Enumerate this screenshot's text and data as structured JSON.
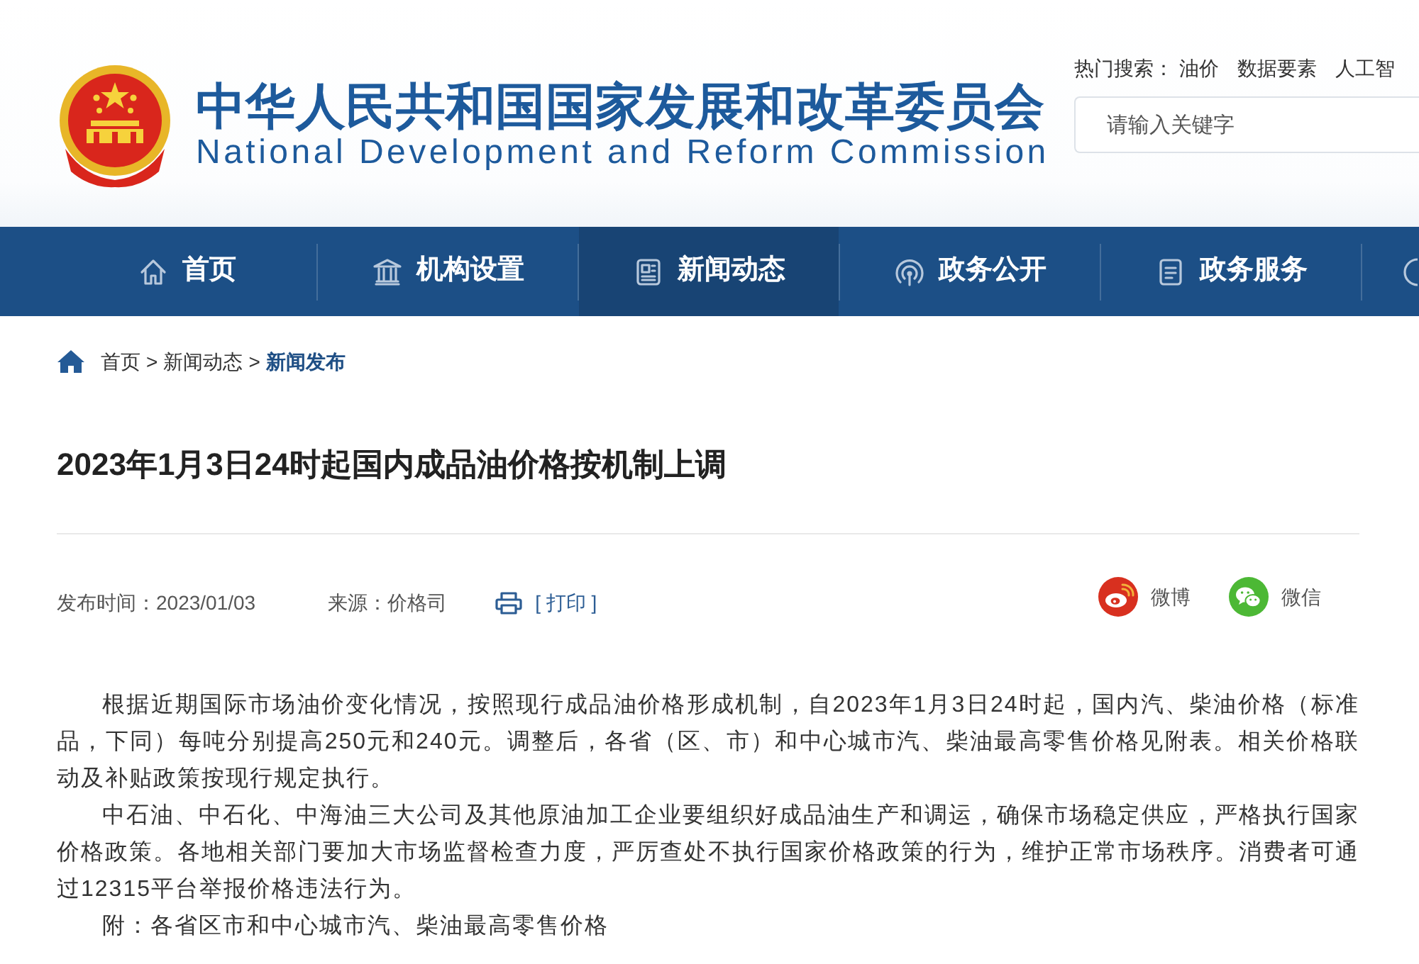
{
  "header": {
    "title_cn": "中华人民共和国国家发展和改革委员会",
    "title_en": "National Development and Reform Commission",
    "hot_search": {
      "label": "热门搜索：",
      "terms": [
        "油价",
        "数据要素",
        "人工智"
      ]
    },
    "search": {
      "placeholder": "请输入关键字"
    }
  },
  "nav": [
    {
      "label": "首页",
      "selected": false
    },
    {
      "label": "机构设置",
      "selected": false
    },
    {
      "label": "新闻动态",
      "selected": true
    },
    {
      "label": "政务公开",
      "selected": false
    },
    {
      "label": "政务服务",
      "selected": false
    }
  ],
  "breadcrumb": {
    "separator": ">",
    "items": [
      {
        "label": "首页",
        "current": false
      },
      {
        "label": "新闻动态",
        "current": false
      },
      {
        "label": "新闻发布",
        "current": true
      }
    ]
  },
  "article": {
    "title": "2023年1月3日24时起国内成品油价格按机制上调",
    "meta": {
      "published": "发布时间：2023/01/03",
      "source": "来源：价格司",
      "print": "[ 打印 ]"
    },
    "share": [
      {
        "kind": "weibo",
        "label": "微博"
      },
      {
        "kind": "wechat",
        "label": "微信"
      }
    ],
    "paragraphs": [
      "根据近期国际市场油价变化情况，按照现行成品油价格形成机制，自2023年1月3日24时起，国内汽、柴油价格（标准品，下同）每吨分别提高250元和240元。调整后，各省（区、市）和中心城市汽、柴油最高零售价格见附表。相关价格联动及补贴政策按现行规定执行。",
      "中石油、中石化、中海油三大公司及其他原油加工企业要组织好成品油生产和调运，确保市场稳定供应，严格执行国家价格政策。各地相关部门要加大市场监督检查力度，严厉查处不执行国家价格政策的行为，维护正常市场秩序。消费者可通过12315平台举报价格违法行为。",
      "附：各省区市和中心城市汽、柴油最高零售价格"
    ]
  }
}
